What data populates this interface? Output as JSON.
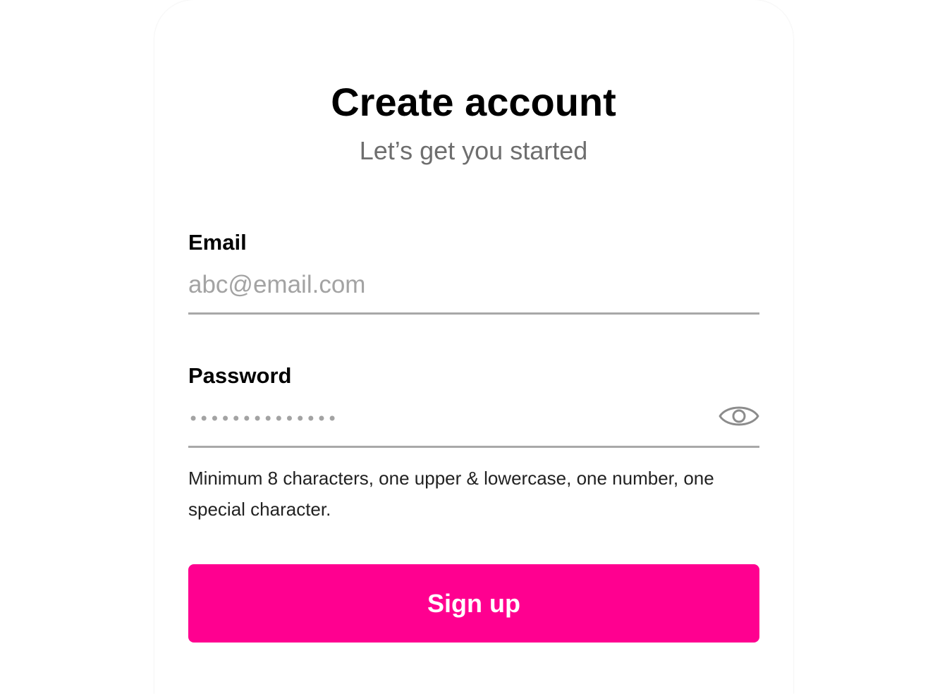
{
  "header": {
    "title": "Create account",
    "subtitle": "Let’s get you started"
  },
  "email": {
    "label": "Email",
    "value": "",
    "placeholder": "abc@email.com"
  },
  "password": {
    "label": "Password",
    "masked_value": "••••••••••••••",
    "toggle_icon": "eye-icon"
  },
  "hint": "Minimum 8 characters, one upper & lowercase, one number, one special character.",
  "submit": {
    "label": "Sign up"
  },
  "colors": {
    "accent": "#ff0090",
    "placeholder": "#a3a3a3",
    "underline": "#a8a8a8",
    "subtitle": "#6e6e6e"
  }
}
